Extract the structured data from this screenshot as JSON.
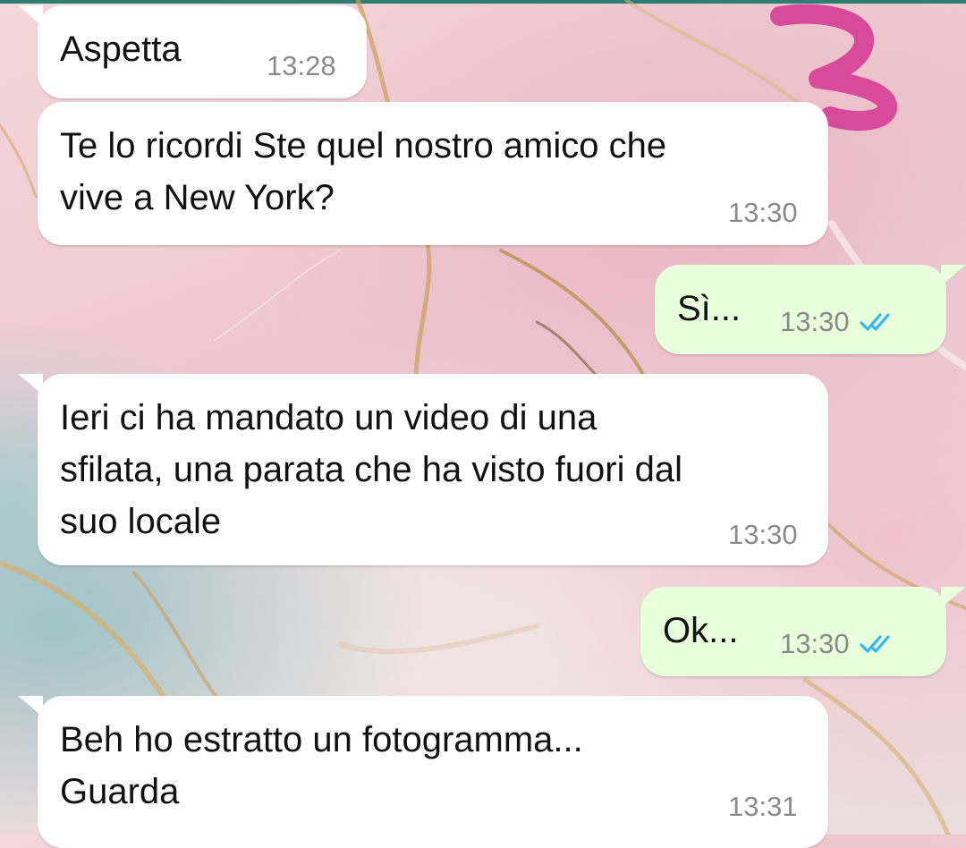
{
  "annotation": {
    "label": "3",
    "color": "#d84a9a"
  },
  "colors": {
    "incoming_bubble": "#ffffff",
    "outgoing_bubble": "#e7ffdb",
    "read_ticks": "#34b7f1",
    "timestamp": "#8a8a8a"
  },
  "messages": [
    {
      "direction": "incoming",
      "text": "Aspetta",
      "time": "13:28"
    },
    {
      "direction": "incoming",
      "text": "Te lo ricordi Ste quel nostro amico che\nvive a New York?",
      "time": "13:30"
    },
    {
      "direction": "outgoing",
      "text": "Sì...",
      "time": "13:30",
      "status": "read",
      "status_icon": "double-check-icon"
    },
    {
      "direction": "incoming",
      "text": "Ieri ci ha mandato un video di una\nsfilata, una parata che ha visto fuori dal\nsuo locale",
      "time": "13:30"
    },
    {
      "direction": "outgoing",
      "text": "Ok...",
      "time": "13:30",
      "status": "read",
      "status_icon": "double-check-icon"
    },
    {
      "direction": "incoming",
      "text": "Beh ho estratto un fotogramma...\nGuarda",
      "time": "13:31"
    }
  ]
}
